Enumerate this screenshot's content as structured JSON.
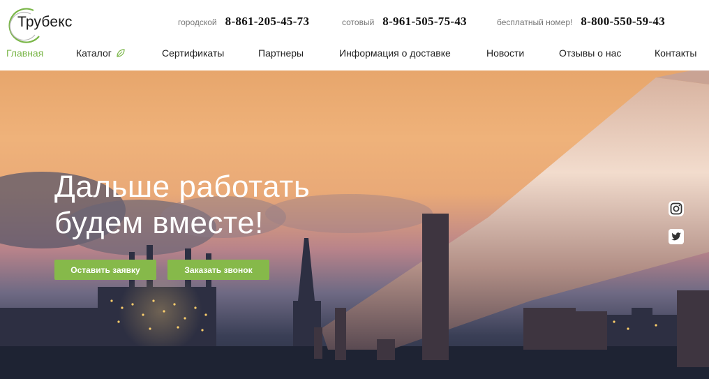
{
  "logo": {
    "text": "Трубекс",
    "accent_color": "#7ab648"
  },
  "phones": [
    {
      "label": "городской",
      "number": "8-861-205-45-73"
    },
    {
      "label": "сотовый",
      "number": "8-961-505-75-43"
    },
    {
      "label": "бесплатный номер!",
      "number": "8-800-550-59-43"
    }
  ],
  "nav": {
    "items": [
      {
        "label": "Главная",
        "active": true
      },
      {
        "label": "Каталог",
        "icon": "leaf-icon"
      },
      {
        "label": "Сертификаты"
      },
      {
        "label": "Партнеры"
      },
      {
        "label": "Информация о доставке"
      },
      {
        "label": "Новости"
      },
      {
        "label": "Отзывы о нас"
      },
      {
        "label": "Контакты"
      }
    ]
  },
  "hero": {
    "title_line1": "Дальше работать",
    "title_line2": "будем вместе!",
    "buttons": [
      {
        "label": "Оставить заявку"
      },
      {
        "label": "Заказать звонок"
      }
    ],
    "social": [
      "instagram-icon",
      "twitter-icon"
    ]
  },
  "colors": {
    "accent": "#7ab648",
    "button": "#86b94a"
  }
}
